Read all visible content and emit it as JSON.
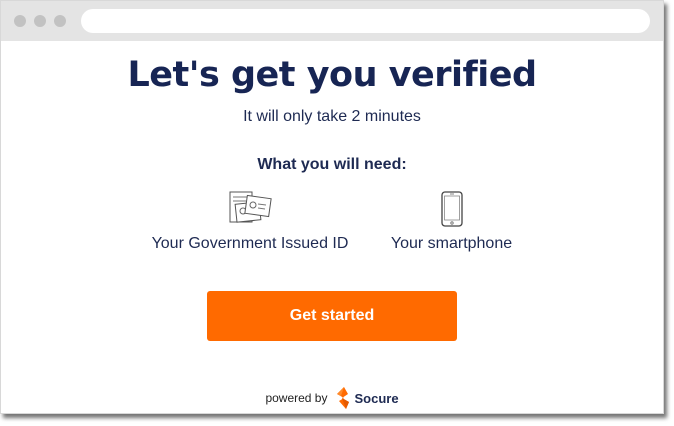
{
  "browser": {
    "dot_color": "#c2c2c2",
    "titlebar_color": "#e4e4e4"
  },
  "page": {
    "title": "Let's get you verified",
    "subtitle": "It will only take 2 minutes"
  },
  "requirements": {
    "heading": "What you will need:",
    "items": [
      {
        "icon": "id-cards-icon",
        "label": "Your Government Issued ID"
      },
      {
        "icon": "smartphone-icon",
        "label": "Your smartphone"
      }
    ]
  },
  "cta": {
    "label": "Get started",
    "color": "#ff6a00"
  },
  "footer": {
    "powered_by": "powered by",
    "brand": "Socure",
    "brand_color": "#ff6a00"
  },
  "colors": {
    "text_primary": "#172554"
  }
}
